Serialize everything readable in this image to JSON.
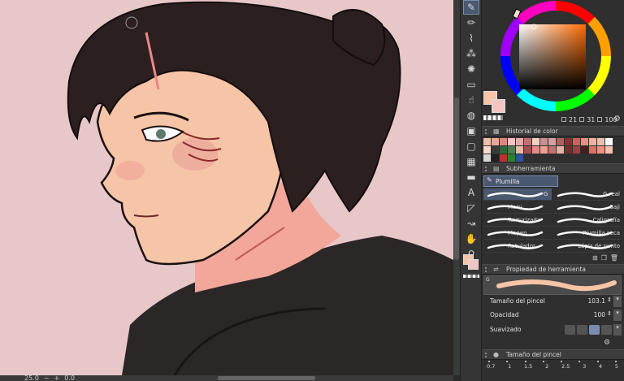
{
  "status": {
    "zoom": "25.0",
    "rotation": "0.0"
  },
  "colors": {
    "skin": "#f6c4a6",
    "background_canvas": "#e8c7c9",
    "hair": "#2c1f1f",
    "hoodie": "#2c2727",
    "main_color": "#f6c4a6",
    "sub_color": "#f2c4c2",
    "accent": "#4a5870"
  },
  "color_wheel": {
    "h": "21",
    "s": "31",
    "v": "100"
  },
  "history_panel": {
    "title": "Historial de color",
    "swatches": [
      [
        "#f0c0a8",
        "#e8a89a",
        "#d98a80",
        "#f2c4c2",
        "#e0b0a8",
        "#c07070",
        "#f4d0c0",
        "#c89090",
        "#d4a0a0",
        "#b06060",
        "#8a3030",
        "#d06060",
        "#e89080",
        "#f0b0a0",
        "#e8c0b0",
        "#ffffff"
      ],
      [
        "#f8d8c8",
        "#3a3a3a",
        "#2a6a3a",
        "#4a8050",
        "#f0b8a8",
        "#a05050",
        "#e88888",
        "#f0a090",
        "#c87070",
        "#e8b0a8",
        "#703030",
        "#a04040",
        "#402020",
        "#e07060",
        "#f09080",
        "#f4c0b0"
      ],
      [
        "#d8d8d8",
        "#202020",
        "#c03030",
        "#308030",
        "#3050a0",
        "#2f2f2f",
        "#2f2f2f",
        "#2f2f2f",
        "#2f2f2f",
        "#2f2f2f",
        "#2f2f2f",
        "#2f2f2f",
        "#2f2f2f",
        "#2f2f2f",
        "#2f2f2f",
        "#2f2f2f"
      ]
    ]
  },
  "subtool_panel": {
    "title": "Subherramienta",
    "tab_label": "Plumilla",
    "brushes": [
      {
        "label": "G",
        "selected": true
      },
      {
        "label": "G real",
        "selected": false
      },
      {
        "label": "Maru",
        "selected": false
      },
      {
        "label": "Saji",
        "selected": false
      },
      {
        "label": "Texturizada",
        "selected": false
      },
      {
        "label": "Caligrafía",
        "selected": false
      },
      {
        "label": "Mapen",
        "selected": false
      },
      {
        "label": "Plumilla seca",
        "selected": false
      },
      {
        "label": "Rotulador",
        "selected": false
      },
      {
        "label": "Lápiz de punto",
        "selected": false
      }
    ]
  },
  "tool_property_panel": {
    "title": "Propiedad de herramienta",
    "preview_label": "G",
    "brush_size_label": "Tamaño del pincel",
    "brush_size_value": "103.1",
    "opacity_label": "Opacidad",
    "opacity_value": "100",
    "smoothing_label": "Suavizado"
  },
  "brush_size_panel": {
    "title": "Tamaño del pincel",
    "sizes": [
      "0.7",
      "1",
      "1.5",
      "2",
      "2.5",
      "3",
      "4",
      "5"
    ]
  },
  "icons": {
    "pen": "✎",
    "pencil": "✏",
    "brush": "🖌",
    "eraser": "⌫",
    "fill": "🪣",
    "text": "A",
    "gradient": "▣",
    "move": "✥",
    "hand": "✋",
    "eyedropper": "⚲"
  }
}
